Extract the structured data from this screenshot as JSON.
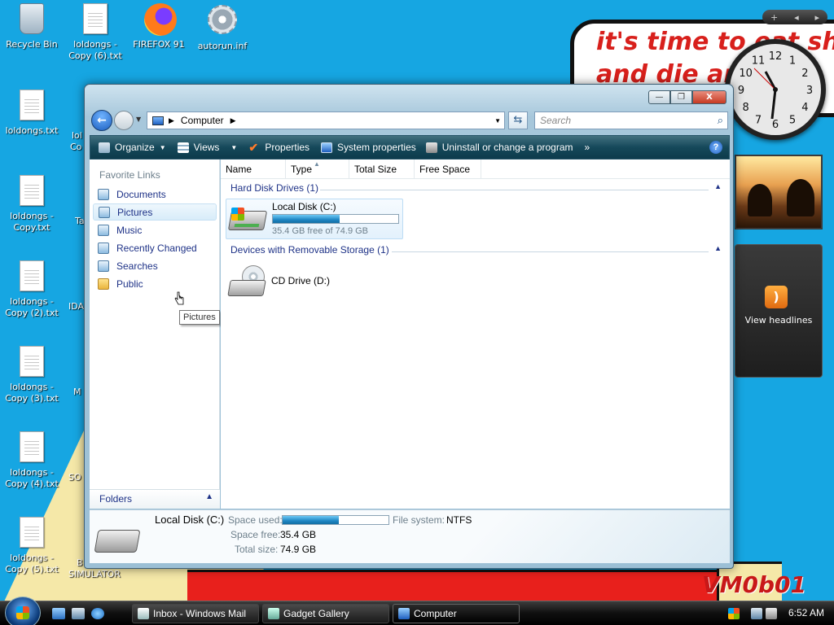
{
  "desktop": {
    "icons": [
      {
        "label": "Recycle Bin"
      },
      {
        "label": "loldongs - Copy (6).txt"
      },
      {
        "label": "FIREFOX 91"
      },
      {
        "label": "autorun.inf"
      },
      {
        "label": "loldongs.txt"
      },
      {
        "label": "loldongs - Copy.txt"
      },
      {
        "label": "loldongs - Copy (2).txt"
      },
      {
        "label": "loldongs - Copy (3).txt"
      },
      {
        "label": "loldongs - Copy (4).txt"
      },
      {
        "label": "loldongs - Copy (5).txt"
      }
    ],
    "partial_labels": [
      "lol",
      "Co",
      "Ta",
      "IDA",
      "M",
      "SO",
      "B",
      "SIMULATOR"
    ],
    "wallpaper": {
      "line1": "it's time to eat shi",
      "line2": "and die ar",
      "signature": "VM0b01"
    }
  },
  "gadgets": {
    "clock_numbers": [
      "12",
      "1",
      "2",
      "3",
      "4",
      "5",
      "6",
      "7",
      "8",
      "9",
      "10",
      "11"
    ],
    "feed_label": "View headlines",
    "toolbar_add": "+",
    "toolbar_prev": "◂",
    "toolbar_next": "▸"
  },
  "window": {
    "controls": {
      "minimize": "—",
      "maximize": "❐",
      "close": "X"
    },
    "address": {
      "root": "Computer"
    },
    "search": {
      "placeholder": "Search"
    },
    "commands": [
      {
        "label": "Organize",
        "icon": "organize-icon",
        "has_dropdown": true
      },
      {
        "label": "Views",
        "icon": "views-icon",
        "has_dropdown": true
      },
      {
        "label": "Properties",
        "icon": "properties-icon"
      },
      {
        "label": "System properties",
        "icon": "system-properties-icon"
      },
      {
        "label": "Uninstall or change a program",
        "icon": "uninstall-icon"
      }
    ],
    "overflow": "»",
    "help": "?",
    "nav": {
      "title": "Favorite Links",
      "links": [
        "Documents",
        "Pictures",
        "Music",
        "Recently Changed",
        "Searches",
        "Public"
      ],
      "highlighted": "Pictures",
      "tooltip": "Pictures",
      "folders_label": "Folders"
    },
    "columns": [
      "Name",
      "Type",
      "Total Size",
      "Free Space"
    ],
    "groups": [
      {
        "title": "Hard Disk Drives (1)",
        "items": [
          {
            "name": "Local Disk (C:)",
            "free_text": "35.4 GB free of 74.9 GB",
            "used_fraction": 0.53
          }
        ]
      },
      {
        "title": "Devices with Removable Storage (1)",
        "items": [
          {
            "name": "CD Drive (D:)"
          }
        ]
      }
    ],
    "details": {
      "title": "Local Disk (C:)",
      "space_used_label": "Space used:",
      "space_used_fraction": 0.53,
      "filesystem_label": "File system:",
      "filesystem_value": "NTFS",
      "space_free_label": "Space free:",
      "space_free_value": "35.4 GB",
      "total_size_label": "Total size:",
      "total_size_value": "74.9 GB"
    }
  },
  "taskbar": {
    "tasks": [
      {
        "label": "Inbox - Windows Mail"
      },
      {
        "label": "Gadget Gallery"
      },
      {
        "label": "Computer",
        "active": true
      }
    ],
    "time": "6:52 AM"
  },
  "colors": {
    "desktop": "#16a6e2",
    "command_bar": "#15485a",
    "link": "#1e3287",
    "progress": "#1e86c4"
  }
}
